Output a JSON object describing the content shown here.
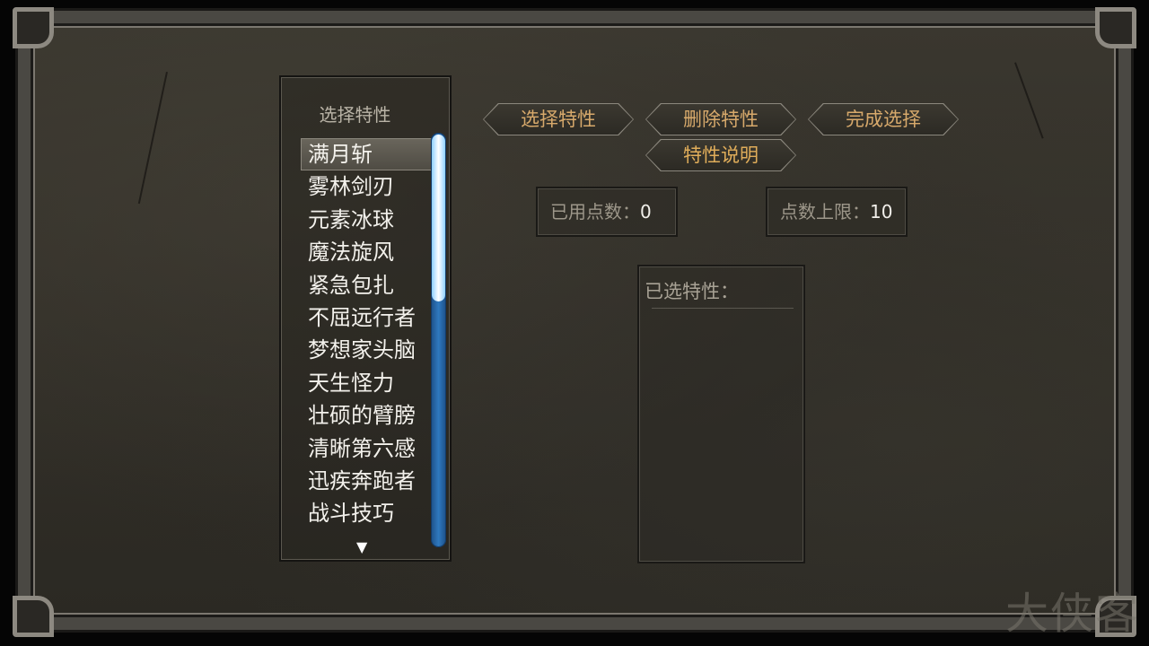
{
  "list_panel": {
    "title": "选择特性",
    "traits": [
      "满月斩",
      "雾林剑刃",
      "元素冰球",
      "魔法旋风",
      "紧急包扎",
      "不屈远行者",
      "梦想家头脑",
      "天生怪力",
      "壮硕的臂膀",
      "清晰第六感",
      "迅疾奔跑者",
      "战斗技巧"
    ],
    "selected_index": 0,
    "scroll_down_icon": "▼"
  },
  "buttons": {
    "select": "选择特性",
    "delete": "删除特性",
    "finish": "完成选择",
    "describe": "特性说明"
  },
  "points": {
    "used_label": "已用点数：",
    "used_value": "0",
    "limit_label": "点数上限：",
    "limit_value": "10"
  },
  "selected_traits": {
    "title": "已选特性："
  },
  "watermark": "大侠客",
  "colors": {
    "button_text": "#d7a96b",
    "scrollbar": "#2f79bf",
    "scroll_thumb": "#8fd0ff"
  }
}
